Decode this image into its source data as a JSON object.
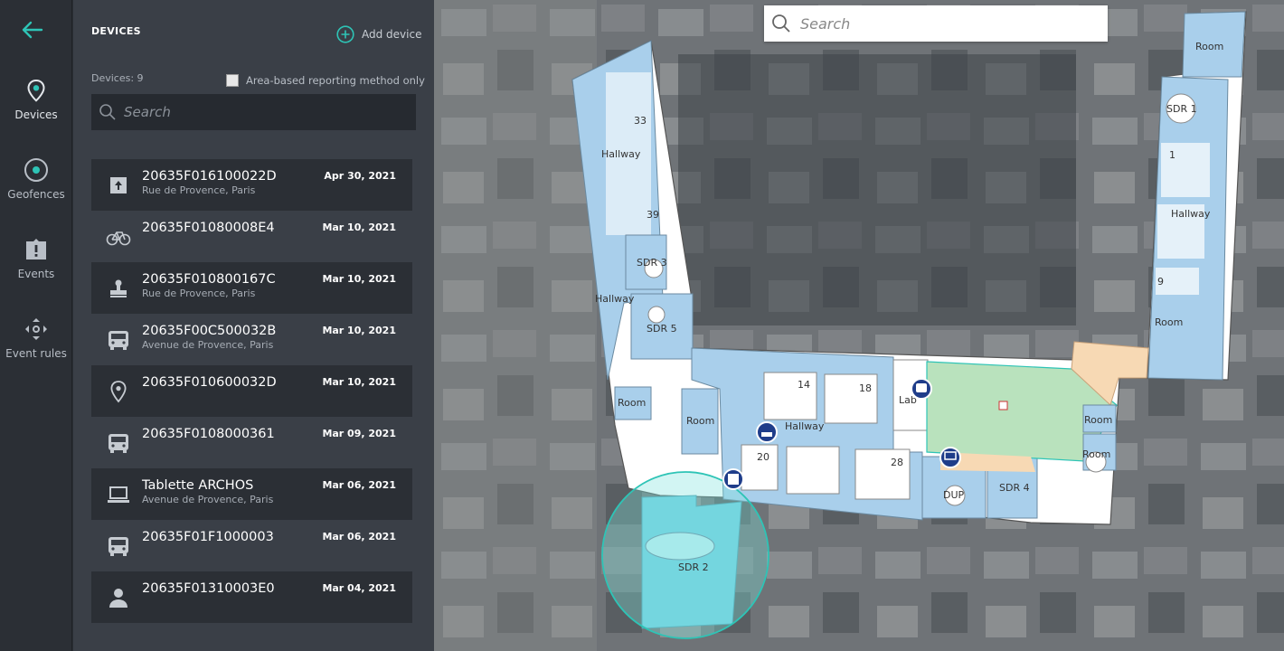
{
  "nav": {
    "items": [
      {
        "label": "Devices",
        "icon": "location-pin-icon"
      },
      {
        "label": "Geofences",
        "icon": "geofence-icon"
      },
      {
        "label": "Events",
        "icon": "alert-tag-icon"
      },
      {
        "label": "Event rules",
        "icon": "event-rules-icon"
      }
    ]
  },
  "panel": {
    "title": "DEVICES",
    "add_label": "Add device",
    "count_label": "Devices: 9",
    "area_checkbox_label": "Area-based reporting method only",
    "search_placeholder": "Search"
  },
  "devices": [
    {
      "name": "20635F016100022D",
      "address": "Rue de Provence, Paris",
      "date": "Apr 30, 2021",
      "icon": "dolly-icon"
    },
    {
      "name": "20635F01080008E4",
      "address": "",
      "date": "Mar 10, 2021",
      "icon": "bicycle-icon"
    },
    {
      "name": "20635F010800167C",
      "address": "Rue de Provence, Paris",
      "date": "Mar 10, 2021",
      "icon": "stamp-icon"
    },
    {
      "name": "20635F00C500032B",
      "address": "Avenue de Provence, Paris",
      "date": "Mar 10, 2021",
      "icon": "bus-icon"
    },
    {
      "name": "20635F010600032D",
      "address": "",
      "date": "Mar 10, 2021",
      "icon": "location-pin-icon"
    },
    {
      "name": "20635F0108000361",
      "address": "",
      "date": "Mar 09, 2021",
      "icon": "bus-icon"
    },
    {
      "name": "Tablette ARCHOS",
      "address": "Avenue de Provence, Paris",
      "date": "Mar 06, 2021",
      "icon": "laptop-icon"
    },
    {
      "name": "20635F01F1000003",
      "address": "",
      "date": "Mar 06, 2021",
      "icon": "bus-icon"
    },
    {
      "name": "20635F01310003E0",
      "address": "",
      "date": "Mar 04, 2021",
      "icon": "person-icon"
    }
  ],
  "map": {
    "search_placeholder": "Search",
    "rooms": {
      "r1": "Room",
      "sdr1": "SDR 1",
      "n1": "1",
      "hallway_r": "Hallway",
      "n9": "9",
      "room_r2": "Room",
      "n33": "33",
      "hallway_l": "Hallway",
      "n39": "39",
      "sdr3": "SDR 3",
      "hallway_l2": "Hallway",
      "sdr5": "SDR 5",
      "room_l": "Room",
      "room_l2": "Room",
      "n14": "14",
      "n18": "18",
      "lab": "Lab",
      "hallway_m": "Hallway",
      "n20": "20",
      "n28": "28",
      "dup": "DUP",
      "sdr4": "SDR 4",
      "room_e1": "Room",
      "room_e2": "Room",
      "sdr2": "SDR 2"
    }
  },
  "colors": {
    "accent": "#2ec4b6",
    "room_blue": "#a9cfeb",
    "room_green": "#b9e2bd",
    "room_orange": "#f7d9b4"
  }
}
